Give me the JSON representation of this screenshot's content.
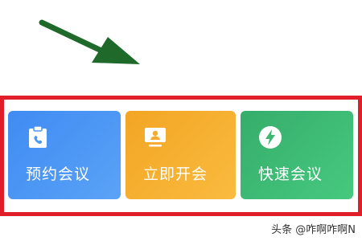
{
  "annotation": {
    "arrow_color": "#1f6a2a",
    "highlight_color": "#e01e29"
  },
  "tiles": [
    {
      "label": "预约会议",
      "icon": "clipboard-phone-icon",
      "color": "#3f8bf2"
    },
    {
      "label": "立即开会",
      "icon": "monitor-person-icon",
      "color": "#f3a524"
    },
    {
      "label": "快速会议",
      "icon": "lightning-icon",
      "color": "#36ad6b"
    }
  ],
  "watermark": "头条 @咋啊咋啊N"
}
